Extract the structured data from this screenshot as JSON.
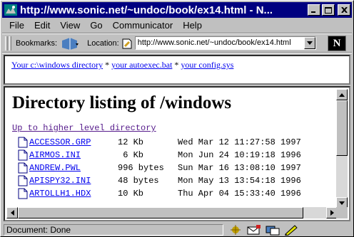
{
  "window": {
    "title": "http://www.sonic.net/~undoc/book/ex14.html - N...",
    "minimize_label": "_",
    "maximize_label": "□",
    "close_label": "✕"
  },
  "menu": [
    "File",
    "Edit",
    "View",
    "Go",
    "Communicator",
    "Help"
  ],
  "location_bar": {
    "bookmarks_label": "Bookmarks:",
    "location_label": "Location:",
    "url": "http://www.sonic.net/~undoc/book/ex14.html",
    "logo": "N"
  },
  "top_frame": {
    "link1": "Your c:\\windows directory",
    "sep1": " * ",
    "link2": "your autoexec.bat",
    "sep2": " * ",
    "link3": "your config.sys"
  },
  "main_frame": {
    "heading": "Directory listing of /windows",
    "up_link": "Up to higher level directory",
    "files": [
      {
        "name": "ACCESSOR.GRP",
        "size": "12 Kb",
        "date": "Wed Mar 12 11:27:58 1997"
      },
      {
        "name": "AIRMOS.INI",
        "size": " 6 Kb",
        "date": "Mon Jun 24 10:19:18 1996"
      },
      {
        "name": "ANDREW.PWL",
        "size": "996 bytes",
        "date": "Sun Mar 16 13:08:10 1997"
      },
      {
        "name": "APISPY32.INI",
        "size": "48 bytes",
        "date": "Mon May 13 13:54:18 1996"
      },
      {
        "name": "ARTOLLH1.HDX",
        "size": "10 Kb",
        "date": "Thu Apr 04 15:33:40 1996"
      }
    ]
  },
  "status": {
    "text": "Document: Done"
  },
  "colors": {
    "titlebar": "#000080",
    "link": "#0000ee",
    "visited": "#551a8b",
    "chrome": "#c0c0c0"
  }
}
